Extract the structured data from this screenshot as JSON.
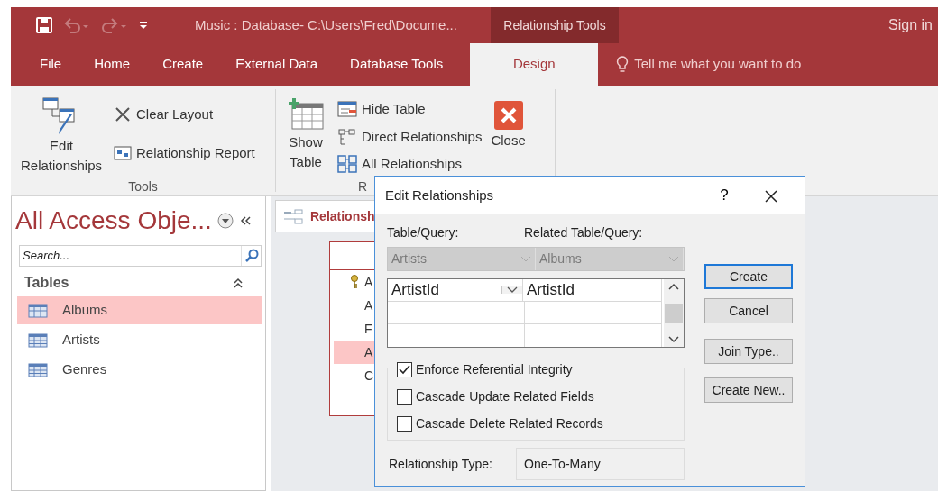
{
  "window": {
    "title": "Music : Database- C:\\Users\\Fred\\Docume...",
    "context_label": "Relationship Tools",
    "sign_in": "Sign in"
  },
  "quick_access": [
    {
      "kind": "save",
      "disabled": false
    },
    {
      "kind": "undo",
      "disabled": true
    },
    {
      "kind": "redo",
      "disabled": true
    },
    {
      "kind": "customize",
      "disabled": false
    }
  ],
  "tabs": [
    {
      "label": "File",
      "selected": false
    },
    {
      "label": "Home",
      "selected": false
    },
    {
      "label": "Create",
      "selected": false
    },
    {
      "label": "External Data",
      "selected": false
    },
    {
      "label": "Database Tools",
      "selected": false
    },
    {
      "label": "Design",
      "selected": true
    }
  ],
  "tell_me": {
    "placeholder": "Tell me what you want to do"
  },
  "ribbon": {
    "groups": [
      {
        "label": "Tools",
        "items": [
          {
            "kind": "large",
            "label": "Edit Relationships"
          },
          {
            "kind": "stack",
            "commands": [
              {
                "label": "Clear Layout"
              },
              {
                "label": "Relationship Report"
              }
            ]
          }
        ]
      },
      {
        "label": "R",
        "items": [
          {
            "kind": "large",
            "label": "Show Table"
          },
          {
            "kind": "stack",
            "commands": [
              {
                "label": "Hide Table"
              },
              {
                "label": "Direct Relationships"
              },
              {
                "label": "All Relationships"
              }
            ]
          },
          {
            "kind": "large",
            "label": "Close"
          }
        ]
      }
    ]
  },
  "nav": {
    "title": "All Access Obje...",
    "search": {
      "placeholder": "Search..."
    },
    "section": "Tables",
    "items": [
      {
        "label": "Albums",
        "selected": true
      },
      {
        "label": "Artists",
        "selected": false
      },
      {
        "label": "Genres",
        "selected": false
      }
    ]
  },
  "document": {
    "tab": "Relationsh",
    "table_fields": [
      {
        "text": "A",
        "key": true,
        "selected": false
      },
      {
        "text": "A",
        "key": false,
        "selected": false
      },
      {
        "text": "F",
        "key": false,
        "selected": false
      },
      {
        "text": "A",
        "key": false,
        "selected": true
      },
      {
        "text": "C",
        "key": false,
        "selected": false
      }
    ]
  },
  "dialog": {
    "title": "Edit Relationships",
    "help": "?",
    "table_label": "Table/Query:",
    "related_label": "Related Table/Query:",
    "table": "Artists",
    "related_table": "Albums",
    "combos_disabled": true,
    "rows": [
      {
        "kind": "filled",
        "left": "ArtistId",
        "right": "ArtistId"
      },
      {
        "kind": "blank"
      },
      {
        "kind": "blank"
      }
    ],
    "options": [
      {
        "label": "Enforce Referential Integrity",
        "checked": true
      },
      {
        "label": "Cascade Update Related Fields",
        "checked": false
      },
      {
        "label": "Cascade Delete Related Records",
        "checked": false
      }
    ],
    "type_label": "Relationship Type:",
    "type_value": "One-To-Many",
    "buttons": [
      {
        "label": "Create",
        "default": true
      },
      {
        "label": "Cancel",
        "default": false
      },
      {
        "label": "Join Type..",
        "default": false
      },
      {
        "label": "Create New..",
        "default": false
      }
    ]
  }
}
